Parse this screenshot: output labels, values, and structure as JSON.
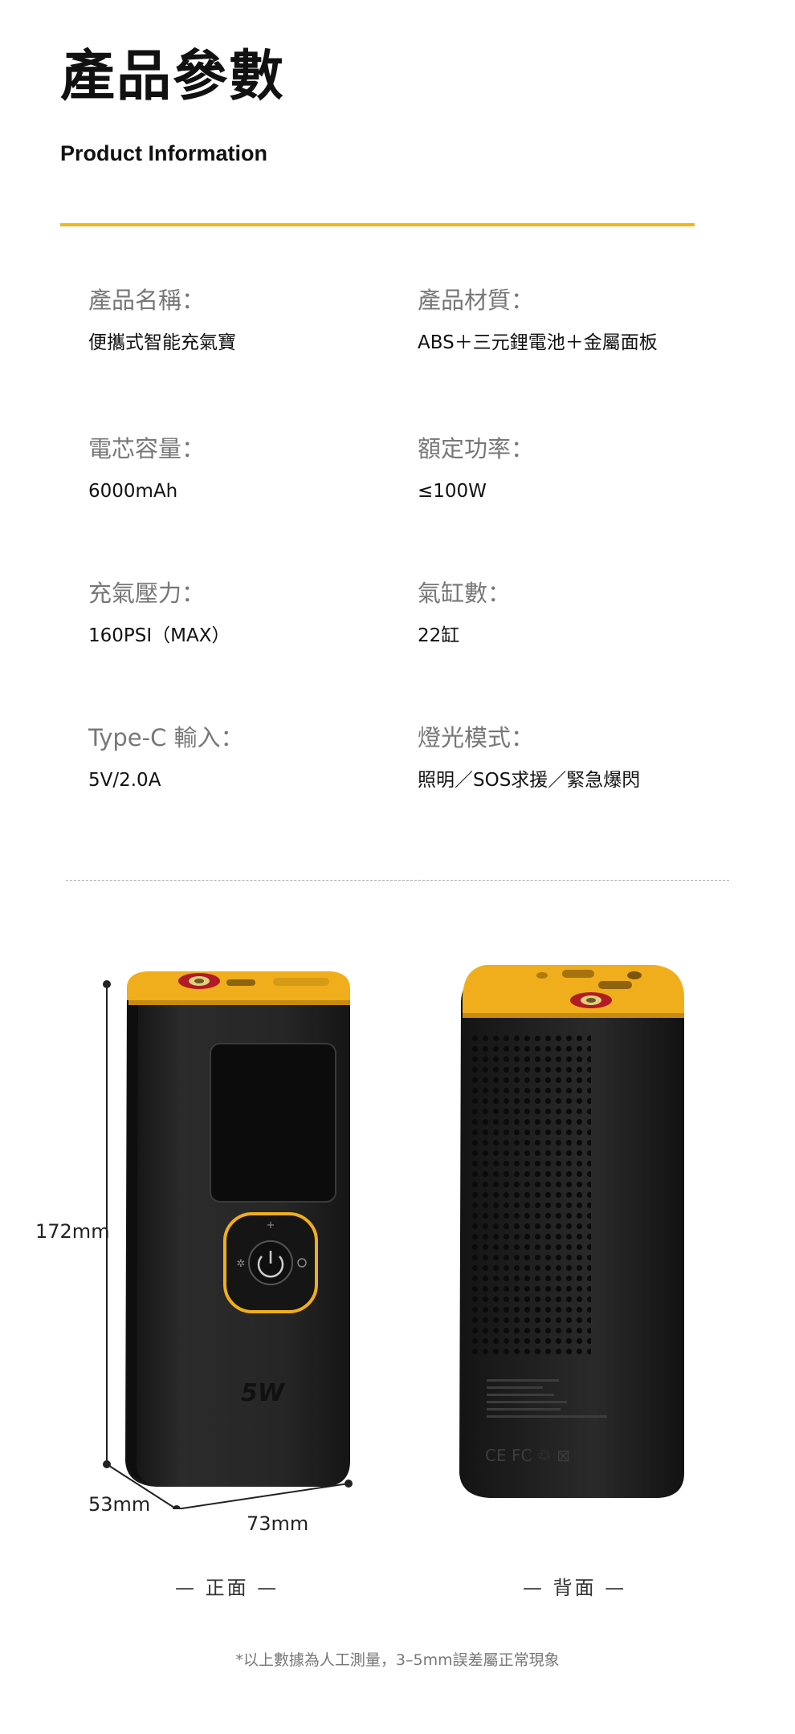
{
  "header": {
    "title_zh": "產品參數",
    "title_en": "Product Information"
  },
  "specs": [
    {
      "label": "產品名稱：",
      "value": "便攜式智能充氣寶"
    },
    {
      "label": "產品材質：",
      "value": "ABS＋三元鋰電池＋金屬面板"
    },
    {
      "label": "電芯容量：",
      "value": "6000mAh"
    },
    {
      "label": "額定功率：",
      "value": "≤100W"
    },
    {
      "label": "充氣壓力：",
      "value": "160PSI（MAX）"
    },
    {
      "label": "氣缸數：",
      "value": "22缸"
    },
    {
      "label": "Type-C 輸入：",
      "value": "5V/2.0A"
    },
    {
      "label": "燈光模式：",
      "value": "照明／SOS求援／緊急爆閃"
    }
  ],
  "dimensions": {
    "height": "172mm",
    "depth": "53mm",
    "width": "73mm"
  },
  "views": {
    "front": "— 正面 —",
    "back": "— 背面 —"
  },
  "footnote": "*以上數據為人工測量，3–5mm誤差屬正常現象",
  "colors": {
    "accent_yellow": "#f3b51c",
    "device_body": "#232323",
    "valve_red": "#c8202a"
  },
  "icons": {
    "power": "power-icon",
    "light": "light-icon",
    "plus": "plus-icon"
  }
}
